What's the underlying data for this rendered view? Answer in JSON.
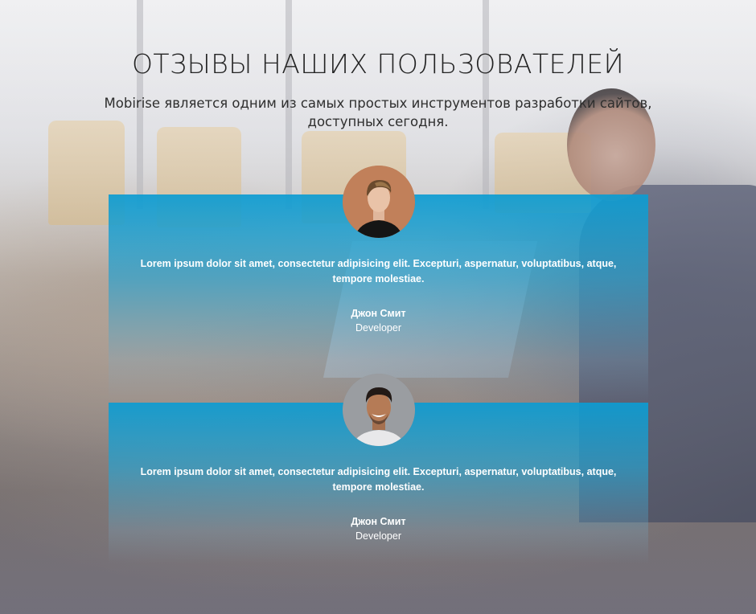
{
  "section": {
    "title": "ОТЗЫВЫ НАШИХ ПОЛЬЗОВАТЕЛЕЙ",
    "subtitle": "Mobirise является одним из самых простых инструментов разработки сайтов, доступных сегодня."
  },
  "testimonials": [
    {
      "avatar_icon": "person-avatar-icon",
      "quote": "Lorem ipsum dolor sit amet, consectetur adipisicing elit. Excepturi, aspernatur, voluptatibus, atque, tempore molestiae.",
      "name": "Джон Смит",
      "role": "Developer"
    },
    {
      "avatar_icon": "person-avatar-icon",
      "quote": "Lorem ipsum dolor sit amet, consectetur adipisicing elit. Excepturi, aspernatur, voluptatibus, atque, tempore molestiae.",
      "name": "Джон Смит",
      "role": "Developer"
    }
  ],
  "colors": {
    "card_accent": "#0c9cd2",
    "title_text": "#232323",
    "card_text": "#ffffff"
  }
}
